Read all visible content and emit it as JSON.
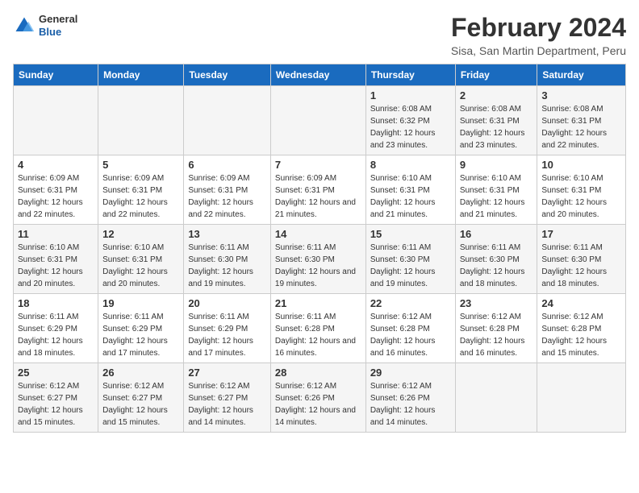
{
  "header": {
    "logo_general": "General",
    "logo_blue": "Blue",
    "main_title": "February 2024",
    "subtitle": "Sisa, San Martin Department, Peru"
  },
  "days_of_week": [
    "Sunday",
    "Monday",
    "Tuesday",
    "Wednesday",
    "Thursday",
    "Friday",
    "Saturday"
  ],
  "weeks": [
    [
      {
        "day": "",
        "info": ""
      },
      {
        "day": "",
        "info": ""
      },
      {
        "day": "",
        "info": ""
      },
      {
        "day": "",
        "info": ""
      },
      {
        "day": "1",
        "info": "Sunrise: 6:08 AM\nSunset: 6:32 PM\nDaylight: 12 hours and 23 minutes."
      },
      {
        "day": "2",
        "info": "Sunrise: 6:08 AM\nSunset: 6:31 PM\nDaylight: 12 hours and 23 minutes."
      },
      {
        "day": "3",
        "info": "Sunrise: 6:08 AM\nSunset: 6:31 PM\nDaylight: 12 hours and 22 minutes."
      }
    ],
    [
      {
        "day": "4",
        "info": "Sunrise: 6:09 AM\nSunset: 6:31 PM\nDaylight: 12 hours and 22 minutes."
      },
      {
        "day": "5",
        "info": "Sunrise: 6:09 AM\nSunset: 6:31 PM\nDaylight: 12 hours and 22 minutes."
      },
      {
        "day": "6",
        "info": "Sunrise: 6:09 AM\nSunset: 6:31 PM\nDaylight: 12 hours and 22 minutes."
      },
      {
        "day": "7",
        "info": "Sunrise: 6:09 AM\nSunset: 6:31 PM\nDaylight: 12 hours and 21 minutes."
      },
      {
        "day": "8",
        "info": "Sunrise: 6:10 AM\nSunset: 6:31 PM\nDaylight: 12 hours and 21 minutes."
      },
      {
        "day": "9",
        "info": "Sunrise: 6:10 AM\nSunset: 6:31 PM\nDaylight: 12 hours and 21 minutes."
      },
      {
        "day": "10",
        "info": "Sunrise: 6:10 AM\nSunset: 6:31 PM\nDaylight: 12 hours and 20 minutes."
      }
    ],
    [
      {
        "day": "11",
        "info": "Sunrise: 6:10 AM\nSunset: 6:31 PM\nDaylight: 12 hours and 20 minutes."
      },
      {
        "day": "12",
        "info": "Sunrise: 6:10 AM\nSunset: 6:31 PM\nDaylight: 12 hours and 20 minutes."
      },
      {
        "day": "13",
        "info": "Sunrise: 6:11 AM\nSunset: 6:30 PM\nDaylight: 12 hours and 19 minutes."
      },
      {
        "day": "14",
        "info": "Sunrise: 6:11 AM\nSunset: 6:30 PM\nDaylight: 12 hours and 19 minutes."
      },
      {
        "day": "15",
        "info": "Sunrise: 6:11 AM\nSunset: 6:30 PM\nDaylight: 12 hours and 19 minutes."
      },
      {
        "day": "16",
        "info": "Sunrise: 6:11 AM\nSunset: 6:30 PM\nDaylight: 12 hours and 18 minutes."
      },
      {
        "day": "17",
        "info": "Sunrise: 6:11 AM\nSunset: 6:30 PM\nDaylight: 12 hours and 18 minutes."
      }
    ],
    [
      {
        "day": "18",
        "info": "Sunrise: 6:11 AM\nSunset: 6:29 PM\nDaylight: 12 hours and 18 minutes."
      },
      {
        "day": "19",
        "info": "Sunrise: 6:11 AM\nSunset: 6:29 PM\nDaylight: 12 hours and 17 minutes."
      },
      {
        "day": "20",
        "info": "Sunrise: 6:11 AM\nSunset: 6:29 PM\nDaylight: 12 hours and 17 minutes."
      },
      {
        "day": "21",
        "info": "Sunrise: 6:11 AM\nSunset: 6:28 PM\nDaylight: 12 hours and 16 minutes."
      },
      {
        "day": "22",
        "info": "Sunrise: 6:12 AM\nSunset: 6:28 PM\nDaylight: 12 hours and 16 minutes."
      },
      {
        "day": "23",
        "info": "Sunrise: 6:12 AM\nSunset: 6:28 PM\nDaylight: 12 hours and 16 minutes."
      },
      {
        "day": "24",
        "info": "Sunrise: 6:12 AM\nSunset: 6:28 PM\nDaylight: 12 hours and 15 minutes."
      }
    ],
    [
      {
        "day": "25",
        "info": "Sunrise: 6:12 AM\nSunset: 6:27 PM\nDaylight: 12 hours and 15 minutes."
      },
      {
        "day": "26",
        "info": "Sunrise: 6:12 AM\nSunset: 6:27 PM\nDaylight: 12 hours and 15 minutes."
      },
      {
        "day": "27",
        "info": "Sunrise: 6:12 AM\nSunset: 6:27 PM\nDaylight: 12 hours and 14 minutes."
      },
      {
        "day": "28",
        "info": "Sunrise: 6:12 AM\nSunset: 6:26 PM\nDaylight: 12 hours and 14 minutes."
      },
      {
        "day": "29",
        "info": "Sunrise: 6:12 AM\nSunset: 6:26 PM\nDaylight: 12 hours and 14 minutes."
      },
      {
        "day": "",
        "info": ""
      },
      {
        "day": "",
        "info": ""
      }
    ]
  ]
}
